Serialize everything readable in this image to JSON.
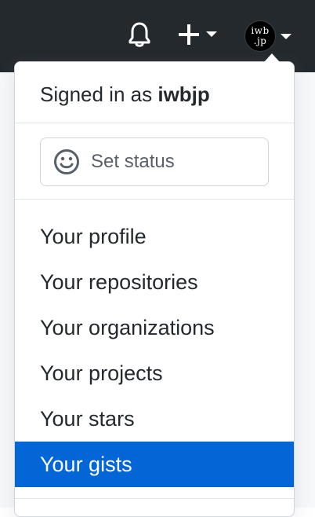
{
  "header": {
    "notifications_icon": "bell-icon",
    "create_icon": "plus-icon",
    "avatar": {
      "line1": "iwb",
      "line2": ".jp"
    }
  },
  "dropdown": {
    "signed_in_prefix": "Signed in as",
    "username": "iwbjp",
    "status_button": {
      "icon": "smiley-icon",
      "label": "Set status"
    },
    "menu_items": [
      {
        "label": "Your profile",
        "active": false
      },
      {
        "label": "Your repositories",
        "active": false
      },
      {
        "label": "Your organizations",
        "active": false
      },
      {
        "label": "Your projects",
        "active": false
      },
      {
        "label": "Your stars",
        "active": false
      },
      {
        "label": "Your gists",
        "active": true
      }
    ]
  },
  "colors": {
    "header_bg": "#24292e",
    "active_bg": "#0366d6",
    "text": "#24292e",
    "muted_text": "#586069"
  }
}
